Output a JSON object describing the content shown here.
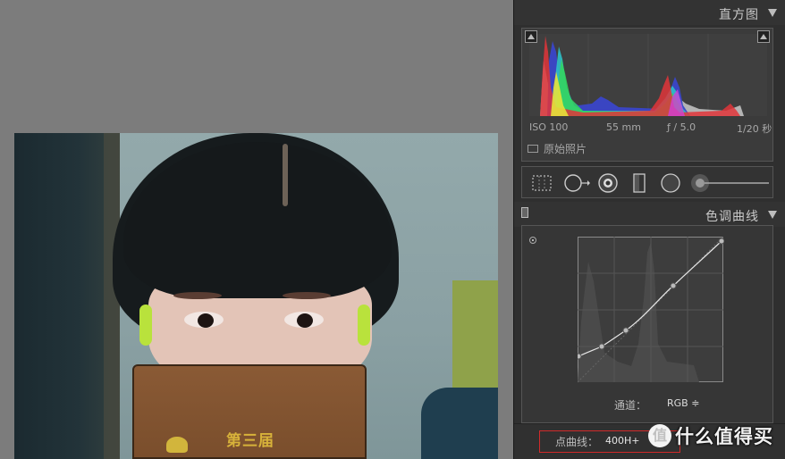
{
  "photo": {
    "book_title": "第三届"
  },
  "histogram": {
    "title": "直方图",
    "iso": "ISO 100",
    "focal_length": "55 mm",
    "aperture": "ƒ / 5.0",
    "shutter": "1/20 秒",
    "original_photo_label": "原始照片"
  },
  "tools": [
    "crop-tool",
    "spot-removal-tool",
    "red-eye-tool",
    "graduated-filter-tool",
    "radial-filter-tool",
    "adjustment-brush-tool"
  ],
  "tone_curve": {
    "title": "色调曲线",
    "channel_label": "通道：",
    "channel_value": "RGB ≑",
    "point_curve_label": "点曲线：",
    "point_curve_value": "400H+",
    "point_curve_arrows": "◆"
  },
  "watermark": {
    "logo": "值",
    "text": "什么值得买"
  },
  "colors": {
    "panel_bg": "#2f2f2f",
    "canvas_bg": "#7c7c7c",
    "highlight": "#d12a2a"
  }
}
